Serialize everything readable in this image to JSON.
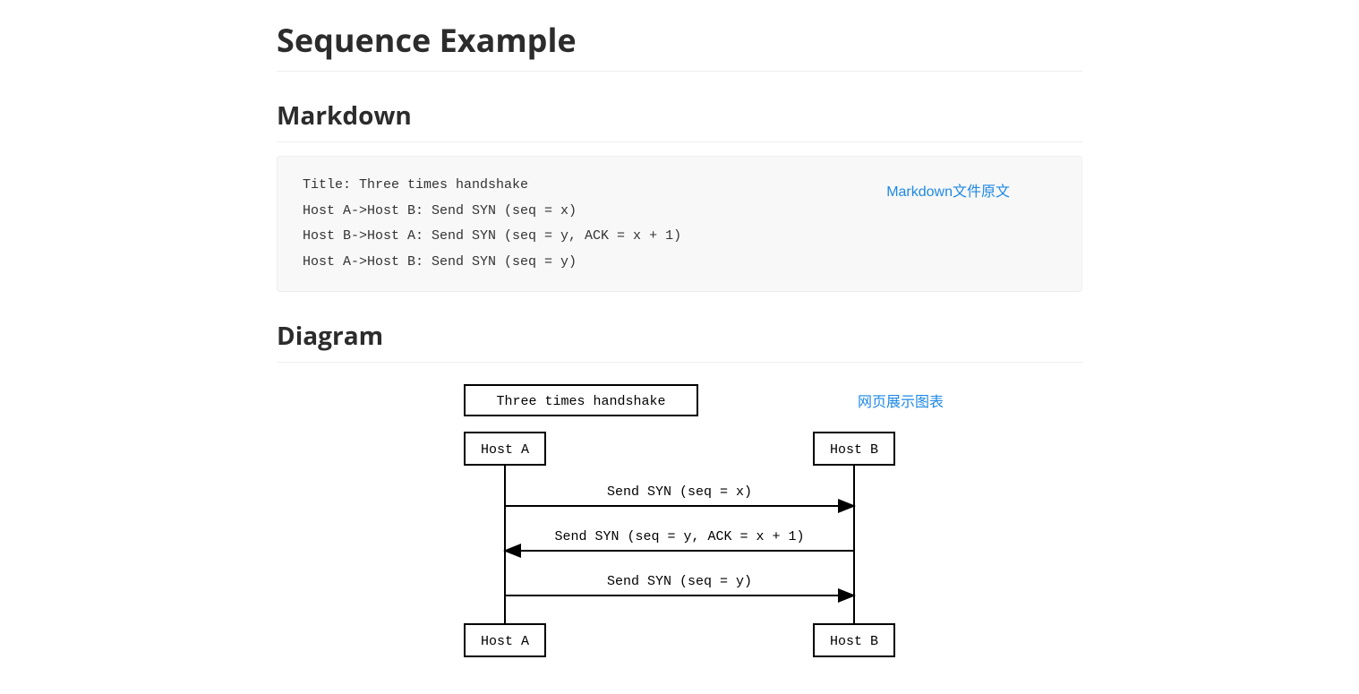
{
  "page_title": "Sequence Example",
  "section_markdown_title": "Markdown",
  "section_diagram_title": "Diagram",
  "code": {
    "line1": "Title: Three times handshake",
    "line2": "Host A->Host B: Send SYN (seq = x)",
    "line3": "Host B->Host A: Send SYN (seq = y, ACK = x + 1)",
    "line4": "Host A->Host B: Send SYN (seq = y)"
  },
  "annotations": {
    "markdown_source": "Markdown文件原文",
    "diagram_display": "网页展示图表"
  },
  "diagram": {
    "title": "Three times handshake",
    "actor_a": "Host A",
    "actor_b": "Host B",
    "msg1": "Send SYN (seq = x)",
    "msg2": "Send SYN (seq = y, ACK = x + 1)",
    "msg3": "Send SYN (seq = y)"
  }
}
